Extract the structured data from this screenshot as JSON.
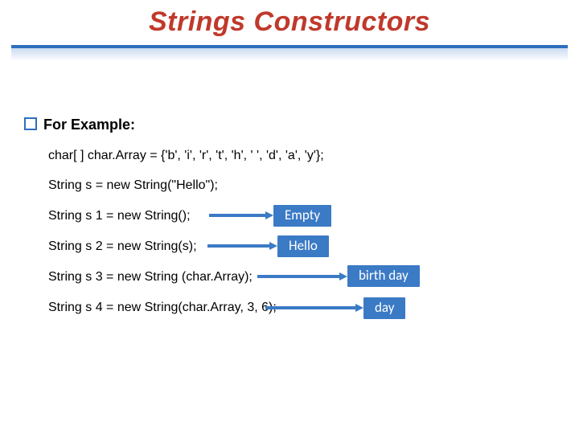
{
  "title": "Strings Constructors",
  "bullet": "For Example:",
  "lines": {
    "l1": "char[ ] char.Array = {'b', 'i', 'r', 't', 'h', ' ',  'd', 'a', 'y'};",
    "l2": "String s = new String(\"Hello\");",
    "l3": "String s 1 = new String();",
    "l4": "String s 2 = new String(s);",
    "l5": "String s 3 = new String (char.Array);",
    "l6": "String s 4 = new String(char.Array, 3, 6);"
  },
  "annotations": {
    "a1": "Empty",
    "a2": "Hello",
    "a3": "birth day",
    "a4": "day"
  }
}
